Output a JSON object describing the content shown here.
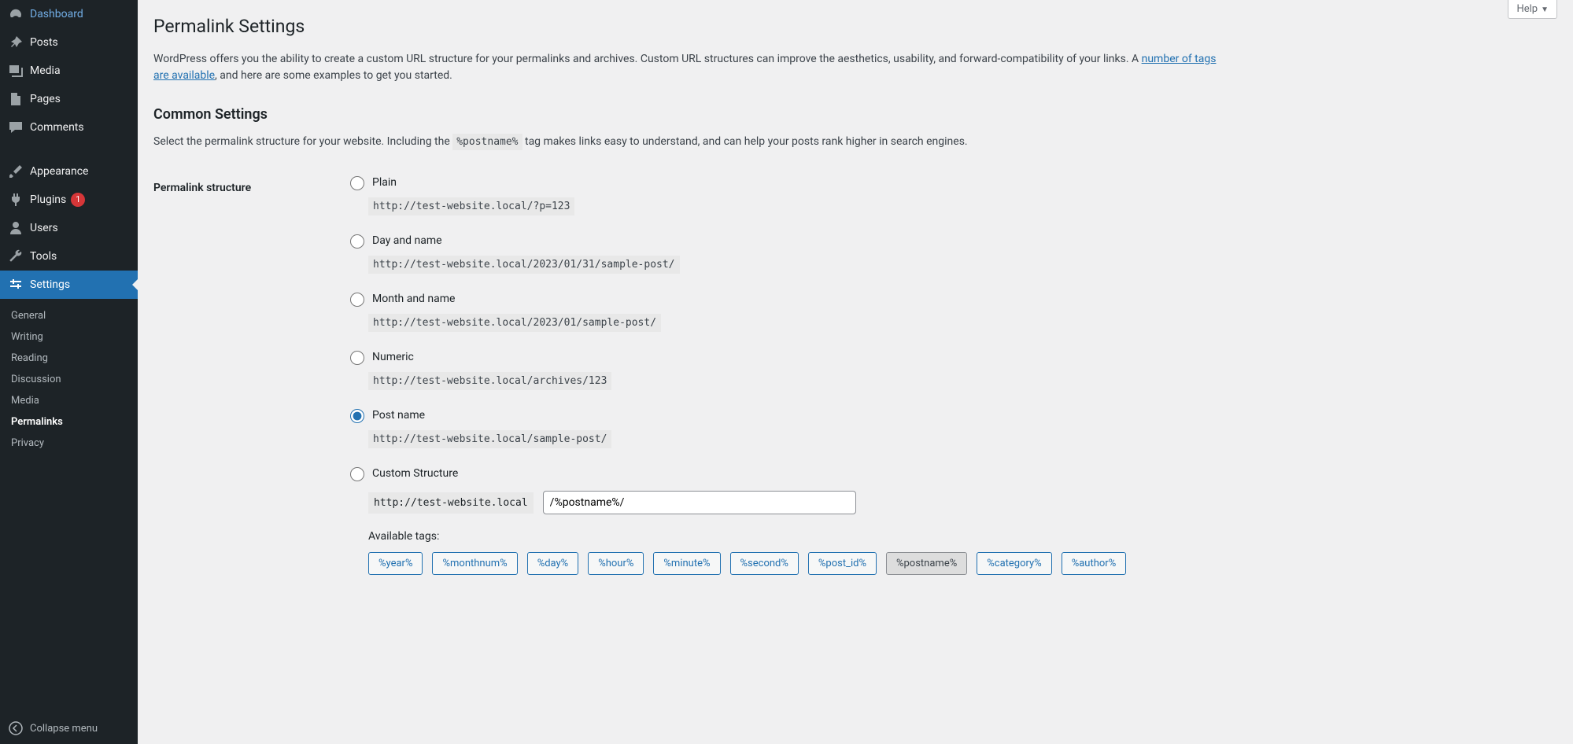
{
  "help_label": "Help",
  "sidebar": {
    "items": [
      {
        "label": "Dashboard",
        "icon": "dash"
      },
      {
        "label": "Posts",
        "icon": "pin"
      },
      {
        "label": "Media",
        "icon": "media"
      },
      {
        "label": "Pages",
        "icon": "page"
      },
      {
        "label": "Comments",
        "icon": "comment"
      },
      {
        "label": "Appearance",
        "icon": "brush"
      },
      {
        "label": "Plugins",
        "icon": "plug",
        "badge": "1"
      },
      {
        "label": "Users",
        "icon": "user"
      },
      {
        "label": "Tools",
        "icon": "wrench"
      },
      {
        "label": "Settings",
        "icon": "sliders",
        "current": true
      }
    ],
    "submenu": [
      {
        "label": "General"
      },
      {
        "label": "Writing"
      },
      {
        "label": "Reading"
      },
      {
        "label": "Discussion"
      },
      {
        "label": "Media"
      },
      {
        "label": "Permalinks",
        "current": true
      },
      {
        "label": "Privacy"
      }
    ],
    "collapse_label": "Collapse menu"
  },
  "page": {
    "title": "Permalink Settings",
    "intro_pre": "WordPress offers you the ability to create a custom URL structure for your permalinks and archives. Custom URL structures can improve the aesthetics, usability, and forward-compatibility of your links. A ",
    "intro_link": "number of tags are available",
    "intro_post": ", and here are some examples to get you started.",
    "common_settings_heading": "Common Settings",
    "sub_pre": "Select the permalink structure for your website. Including the ",
    "sub_tag": "%postname%",
    "sub_post": " tag makes links easy to understand, and can help your posts rank higher in search engines.",
    "structure_label": "Permalink structure",
    "options": [
      {
        "label": "Plain",
        "example": "http://test-website.local/?p=123",
        "checked": false
      },
      {
        "label": "Day and name",
        "example": "http://test-website.local/2023/01/31/sample-post/",
        "checked": false
      },
      {
        "label": "Month and name",
        "example": "http://test-website.local/2023/01/sample-post/",
        "checked": false
      },
      {
        "label": "Numeric",
        "example": "http://test-website.local/archives/123",
        "checked": false
      },
      {
        "label": "Post name",
        "example": "http://test-website.local/sample-post/",
        "checked": true
      },
      {
        "label": "Custom Structure",
        "checked": false
      }
    ],
    "custom_base": "http://test-website.local",
    "custom_value": "/%postname%/",
    "available_tags_label": "Available tags:",
    "tags": [
      "%year%",
      "%monthnum%",
      "%day%",
      "%hour%",
      "%minute%",
      "%second%",
      "%post_id%",
      "%postname%",
      "%category%",
      "%author%"
    ],
    "active_tag": "%postname%"
  }
}
